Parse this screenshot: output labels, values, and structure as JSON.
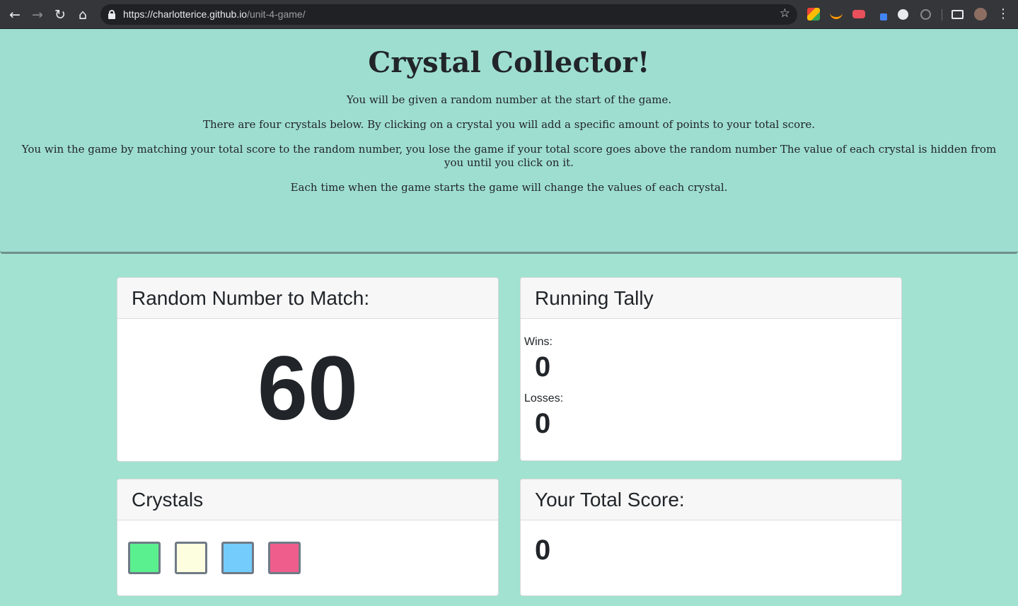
{
  "browser": {
    "url_host": "https://charlotterice.github.io",
    "url_path": "/unit-4-game/"
  },
  "page": {
    "title": "Crystal Collector!",
    "instructions": [
      "You will be given a random number at the start of the game.",
      "There are four crystals below. By clicking on a crystal you will add a specific amount of points to your total score.",
      "You win the game by matching your total score to the random number, you lose the game if your total score goes above the random number The value of each crystal is hidden from you until you click on it.",
      "Each time when the game starts the game will change the values of each crystal."
    ]
  },
  "random_card": {
    "header": "Random Number to Match:",
    "value": "60"
  },
  "tally_card": {
    "header": "Running Tally",
    "wins_label": "Wins:",
    "wins_value": "0",
    "losses_label": "Losses:",
    "losses_value": "0"
  },
  "crystals_card": {
    "header": "Crystals",
    "crystals": [
      {
        "name": "green",
        "color": "#5bf08f"
      },
      {
        "name": "cream",
        "color": "#fdfde0"
      },
      {
        "name": "blue",
        "color": "#74ccfc"
      },
      {
        "name": "pink",
        "color": "#ef5d8c"
      }
    ]
  },
  "score_card": {
    "header": "Your Total Score:",
    "value": "0"
  }
}
